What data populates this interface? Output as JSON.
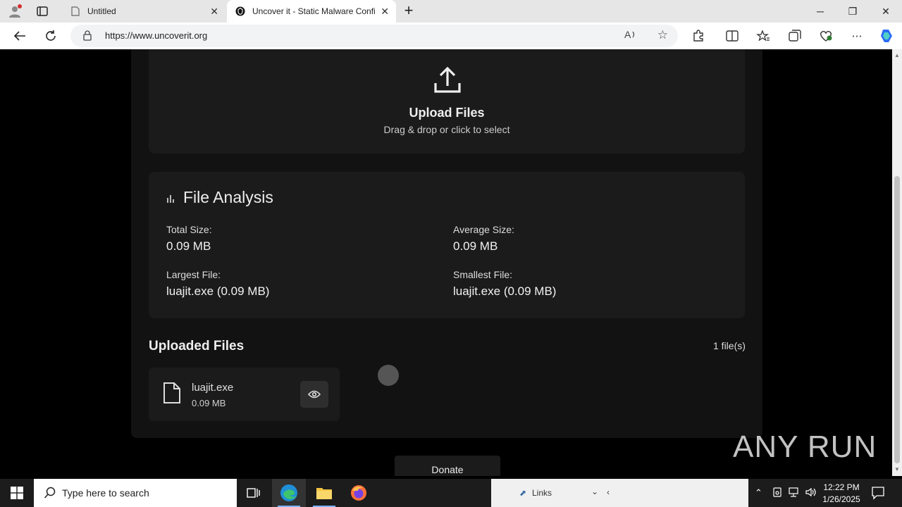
{
  "browser": {
    "tabs": [
      {
        "title": "Untitled",
        "close": "✕"
      },
      {
        "title": "Uncover it - Static Malware Confi",
        "close": "✕"
      }
    ],
    "new_tab": "+",
    "window": {
      "minimize": "─",
      "restore": "❐",
      "close": "✕"
    },
    "url": "https://www.uncoverit.org",
    "read_aloud": "Á⁾"
  },
  "upload": {
    "title": "Upload Files",
    "subtitle": "Drag & drop or click to select"
  },
  "analysis": {
    "title": "File Analysis",
    "stats": [
      {
        "label": "Total Size:",
        "value": "0.09 MB"
      },
      {
        "label": "Average Size:",
        "value": "0.09 MB"
      },
      {
        "label": "Largest File:",
        "value": "luajit.exe (0.09 MB)"
      },
      {
        "label": "Smallest File:",
        "value": "luajit.exe (0.09 MB)"
      }
    ]
  },
  "uploaded": {
    "title": "Uploaded Files",
    "count": "1 file(s)",
    "files": [
      {
        "name": "luajit.exe",
        "size": "0.09 MB"
      }
    ]
  },
  "donate": "Donate",
  "watermark": "ANY RUN",
  "taskbar": {
    "search_placeholder": "Type here to search",
    "bg_window_label": "Links",
    "time": "12:22 PM",
    "date": "1/26/2025"
  }
}
